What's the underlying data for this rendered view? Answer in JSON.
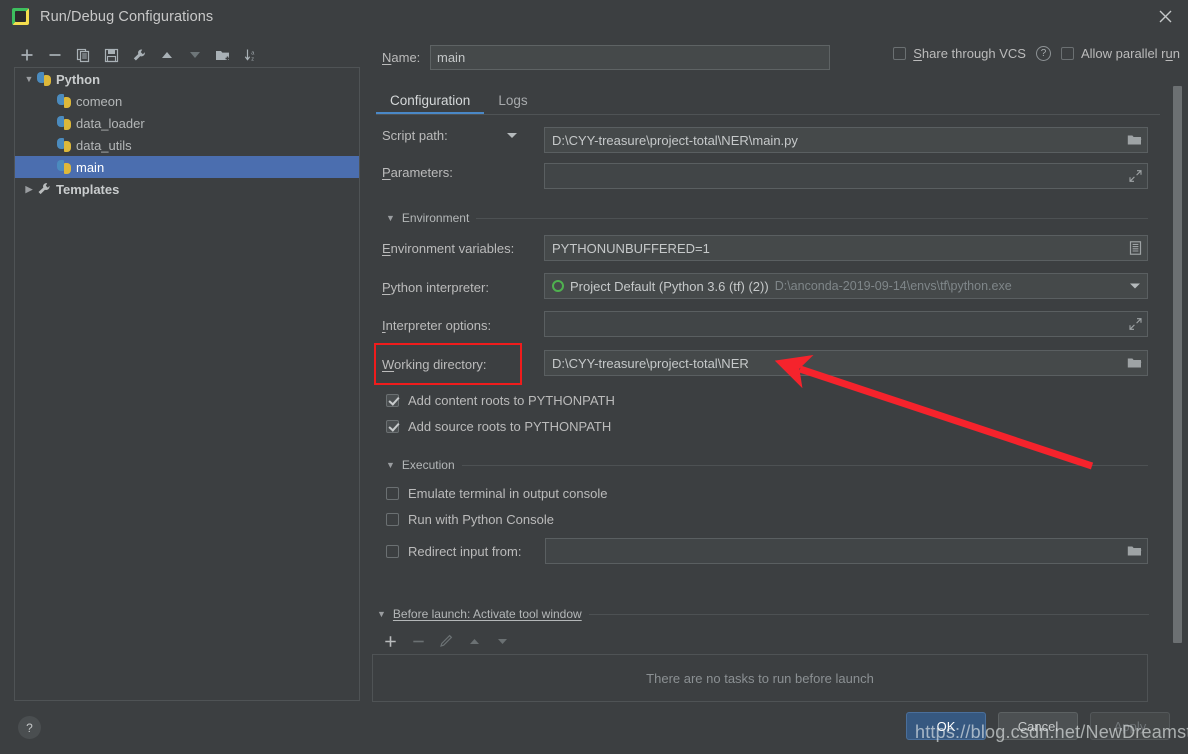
{
  "window": {
    "title": "Run/Debug Configurations",
    "app_icon": "pycharm-icon",
    "close_icon": "close-icon"
  },
  "toolbar": {
    "buttons": [
      {
        "name": "add-configuration-button",
        "icon": "plus-icon",
        "enabled": true
      },
      {
        "name": "remove-configuration-button",
        "icon": "minus-icon",
        "enabled": true
      },
      {
        "name": "copy-configuration-button",
        "icon": "copy-icon",
        "enabled": true
      },
      {
        "name": "save-configuration-button",
        "icon": "save-icon",
        "enabled": true
      },
      {
        "name": "edit-templates-button",
        "icon": "wrench-icon",
        "enabled": true
      },
      {
        "name": "move-up-button",
        "icon": "arrow-up-icon",
        "enabled": true
      },
      {
        "name": "move-down-button",
        "icon": "arrow-down-icon",
        "enabled": false
      },
      {
        "name": "new-folder-button",
        "icon": "new-folder-icon",
        "enabled": true
      },
      {
        "name": "sort-configurations-button",
        "icon": "sort-az-icon",
        "enabled": true
      }
    ]
  },
  "tree": {
    "nodes": [
      {
        "label": "Python",
        "level": 0,
        "expanded": true,
        "icon": "python-icon",
        "selected": false,
        "bold": true
      },
      {
        "label": "comeon",
        "level": 1,
        "expanded": null,
        "icon": "python-icon",
        "selected": false,
        "bold": false
      },
      {
        "label": "data_loader",
        "level": 1,
        "expanded": null,
        "icon": "python-icon",
        "selected": false,
        "bold": false
      },
      {
        "label": "data_utils",
        "level": 1,
        "expanded": null,
        "icon": "python-icon",
        "selected": false,
        "bold": false
      },
      {
        "label": "main",
        "level": 1,
        "expanded": null,
        "icon": "python-icon",
        "selected": true,
        "bold": false
      },
      {
        "label": "Templates",
        "level": 0,
        "expanded": false,
        "icon": "wrench-icon",
        "selected": false,
        "bold": true
      }
    ]
  },
  "name_field": {
    "label": "Name:",
    "label_mnemonic": "N",
    "value": "main",
    "placeholder": ""
  },
  "top_options": {
    "share_vcs": {
      "label": "Share through VCS",
      "label_mnemonic": "S",
      "checked": false
    },
    "help_icon": "question-mark-icon",
    "allow_parallel": {
      "label": "Allow parallel run",
      "label_mnemonic": "u",
      "checked": false
    }
  },
  "tabs": [
    {
      "label": "Configuration",
      "active": true
    },
    {
      "label": "Logs",
      "active": false
    }
  ],
  "fields": {
    "script_path": {
      "label": "Script path:",
      "value": "D:\\CYY-treasure\\project-total\\NER\\main.py",
      "icon": "folder-icon",
      "has_dropdown": true
    },
    "parameters": {
      "label": "Parameters:",
      "label_mnemonic": "P",
      "value": "",
      "icon": "expand-icon"
    },
    "environment_section": {
      "label": "Environment",
      "expanded": true
    },
    "environment_variables": {
      "label": "Environment variables:",
      "label_mnemonic": "E",
      "value": "PYTHONUNBUFFERED=1",
      "icon": "env-list-icon"
    },
    "python_interpreter": {
      "label": "Python interpreter:",
      "label_mnemonic": "P",
      "value": "Project Default (Python 3.6 (tf) (2))",
      "value_path": "D:\\anconda-2019-09-14\\envs\\tf\\python.exe",
      "status_icon": "python-env-icon",
      "icon": "chevron-down-icon"
    },
    "interpreter_options": {
      "label": "Interpreter options:",
      "label_mnemonic": "I",
      "value": "",
      "icon": "expand-icon"
    },
    "working_directory": {
      "label": "Working directory:",
      "label_mnemonic": "W",
      "value": "D:\\CYY-treasure\\project-total\\NER",
      "icon": "folder-icon",
      "highlighted": true
    },
    "add_content_roots": {
      "label": "Add content roots to PYTHONPATH",
      "checked": true
    },
    "add_source_roots": {
      "label": "Add source roots to PYTHONPATH",
      "checked": true
    },
    "execution_section": {
      "label": "Execution",
      "expanded": true
    },
    "emulate_terminal": {
      "label": "Emulate terminal in output console",
      "checked": false
    },
    "run_with_console": {
      "label": "Run with Python Console",
      "checked": false
    },
    "redirect_input": {
      "label": "Redirect input from:",
      "checked": false,
      "value": "",
      "icon": "folder-icon"
    }
  },
  "before_launch": {
    "section_label": "Before launch: Activate tool window",
    "section_mnemonic": "B",
    "expanded": true,
    "toolbar": [
      {
        "name": "add-task-button",
        "icon": "plus-icon",
        "enabled": true
      },
      {
        "name": "remove-task-button",
        "icon": "minus-icon",
        "enabled": false
      },
      {
        "name": "edit-task-button",
        "icon": "pencil-icon",
        "enabled": false
      },
      {
        "name": "task-move-up-button",
        "icon": "arrow-up-icon",
        "enabled": false
      },
      {
        "name": "task-move-down-button",
        "icon": "arrow-down-icon",
        "enabled": false
      }
    ],
    "empty_text": "There are no tasks to run before launch"
  },
  "footer": {
    "help_label": "?",
    "ok_label": "OK",
    "cancel_label": "Cancel",
    "apply_label": "Apply",
    "apply_enabled": false
  },
  "watermark": {
    "text": "https://blog.csdn.net/NewDreamstyle"
  },
  "annotations": {
    "highlight_color": "#f01c1c",
    "arrow_color": "#f5232c",
    "box_target": "working-directory-label",
    "arrow_target": "working-directory-input"
  },
  "colors": {
    "background": "#3c3f41",
    "field_background": "#45494a",
    "selection": "#4b6eaf",
    "accent": "#4a88c7",
    "primary_button": "#365880",
    "text": "#bbbbbb"
  }
}
